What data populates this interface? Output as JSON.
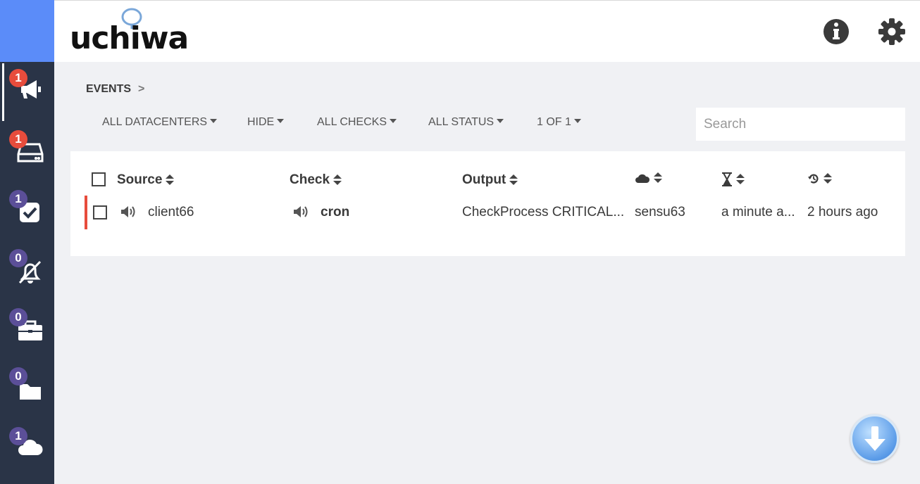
{
  "app": {
    "logo_text": "uchiwa"
  },
  "sidebar": {
    "items": [
      {
        "name": "events",
        "icon": "megaphone-icon",
        "badge": "1",
        "badge_color": "#e74c3c",
        "active": true
      },
      {
        "name": "clients",
        "icon": "server-icon",
        "badge": "1",
        "badge_color": "#e74c3c"
      },
      {
        "name": "checks",
        "icon": "check-square-icon",
        "badge": "1",
        "badge_color": "#5b4f98"
      },
      {
        "name": "silenced",
        "icon": "bell-slash-icon",
        "badge": "0",
        "badge_color": "#5b4f98"
      },
      {
        "name": "stashes",
        "icon": "briefcase-icon",
        "badge": "0",
        "badge_color": "#5b4f98"
      },
      {
        "name": "aggregates",
        "icon": "folder-icon",
        "badge": "0",
        "badge_color": "#5b4f98"
      },
      {
        "name": "datacenters",
        "icon": "cloud-icon",
        "badge": "1",
        "badge_color": "#5b4f98"
      }
    ]
  },
  "header": {
    "info_icon": "info-icon",
    "settings_icon": "gear-icon"
  },
  "breadcrumb": {
    "label": "EVENTS",
    "separator": ">"
  },
  "filters": {
    "datacenters": "ALL DATACENTERS",
    "hide": "HIDE",
    "checks": "ALL CHECKS",
    "status": "ALL STATUS",
    "pagination": "1 OF 1"
  },
  "search": {
    "placeholder": "Search",
    "value": ""
  },
  "table": {
    "columns": {
      "source": "Source",
      "check": "Check",
      "output": "Output"
    },
    "column_icons": {
      "datacenter": "cloud-icon",
      "issued": "hourglass-icon",
      "last_check": "history-icon"
    },
    "rows": [
      {
        "source": "client66",
        "check": "cron",
        "output": "CheckProcess CRITICAL...",
        "datacenter": "sensu63",
        "issued": "a minute a...",
        "last_check": "2 hours ago",
        "status_color": "#e74c3c"
      }
    ]
  },
  "fab": {
    "icon": "arrow-down-icon"
  }
}
